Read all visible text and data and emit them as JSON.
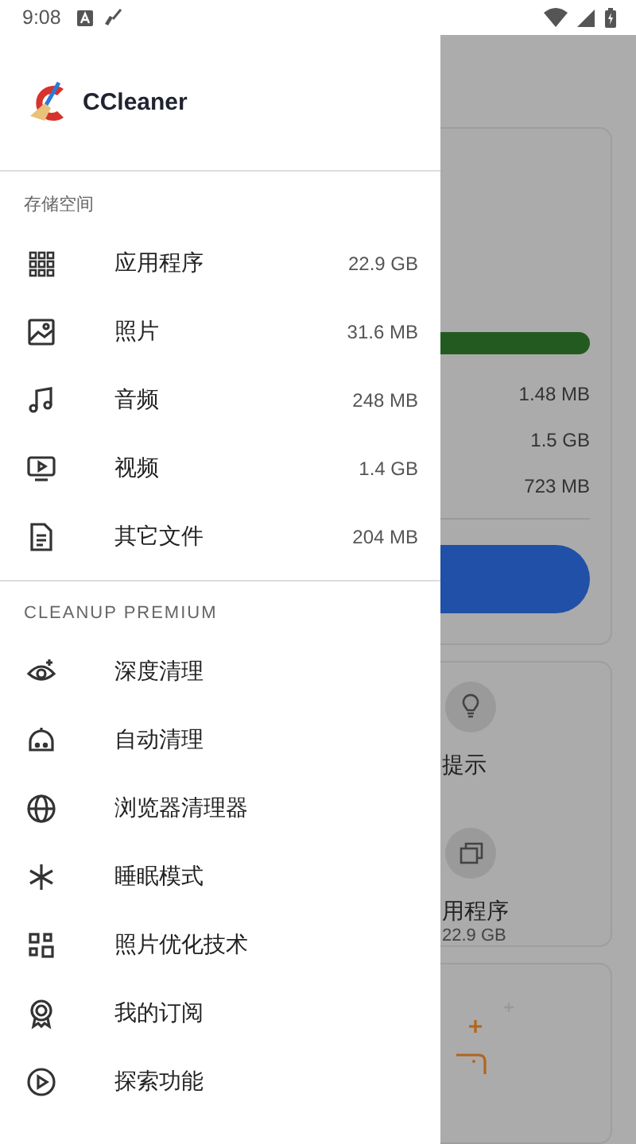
{
  "status_bar": {
    "time": "9:08"
  },
  "drawer": {
    "app_name": "CCleaner",
    "storage_section": {
      "title": "存储空间",
      "items": [
        {
          "label": "应用程序",
          "size": "22.9 GB"
        },
        {
          "label": "照片",
          "size": "31.6 MB"
        },
        {
          "label": "音频",
          "size": "248 MB"
        },
        {
          "label": "视频",
          "size": "1.4 GB"
        },
        {
          "label": "其它文件",
          "size": "204 MB"
        }
      ]
    },
    "premium_section": {
      "title": "CLEANUP PREMIUM",
      "items": [
        {
          "label": "深度清理"
        },
        {
          "label": "自动清理"
        },
        {
          "label": "浏览器清理器"
        },
        {
          "label": "睡眠模式"
        },
        {
          "label": "照片优化技术"
        },
        {
          "label": "我的订阅"
        },
        {
          "label": "探索功能"
        }
      ]
    }
  },
  "background": {
    "storage_card": {
      "readings": [
        "1.48 MB",
        "1.5 GB",
        "723 MB"
      ]
    },
    "tiles": [
      {
        "label": "提示"
      },
      {
        "label": "用程序",
        "sub": "22.9 GB"
      }
    ]
  }
}
